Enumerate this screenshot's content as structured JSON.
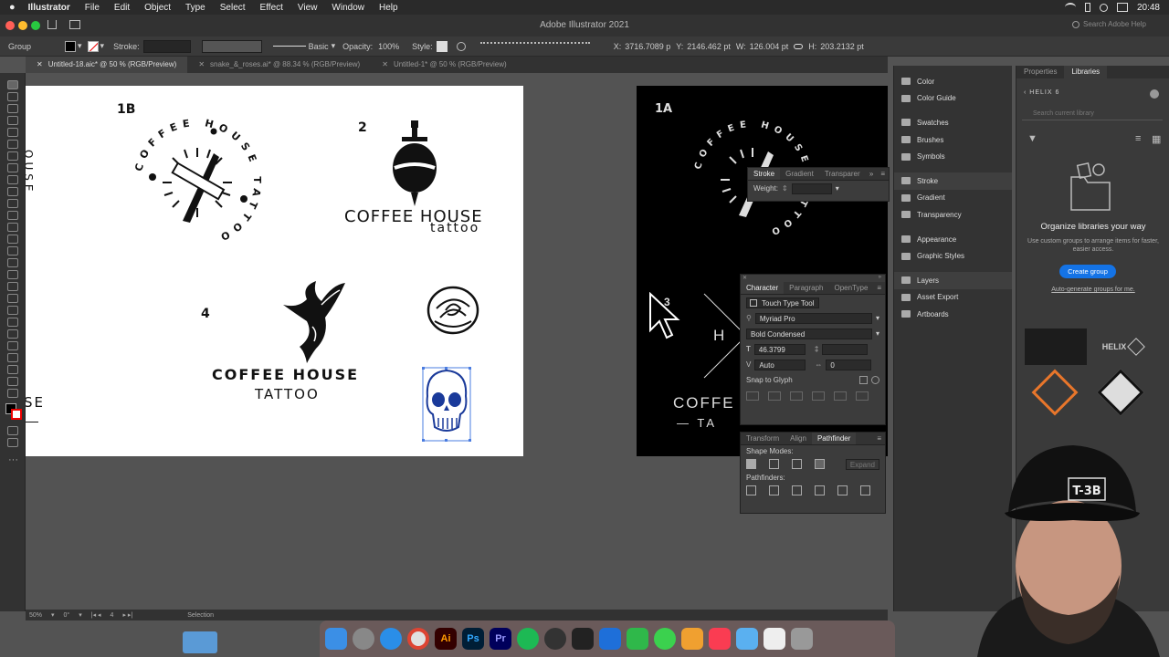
{
  "menubar": {
    "app_name": "Illustrator",
    "items": [
      "File",
      "Edit",
      "Object",
      "Type",
      "Select",
      "Effect",
      "View",
      "Window",
      "Help"
    ],
    "clock": "20:48"
  },
  "window": {
    "title": "Adobe Illustrator 2021",
    "search_placeholder": "Search Adobe Help"
  },
  "controlbar": {
    "selection_type": "Group",
    "stroke_label": "Stroke:",
    "brush_label": "Basic",
    "opacity_label": "Opacity:",
    "opacity_value": "100%",
    "style_label": "Style:",
    "x_label": "X:",
    "x_value": "3716.7089 p",
    "y_label": "Y:",
    "y_value": "2146.462 pt",
    "w_label": "W:",
    "w_value": "126.004 pt",
    "h_label": "H:",
    "h_value": "203.2132 pt"
  },
  "tabs": [
    {
      "label": "Untitled-18.aic* @ 50 % (RGB/Preview)"
    },
    {
      "label": "snake_&_roses.ai* @ 88.34 % (RGB/Preview)"
    },
    {
      "label": "Untitled-1* @ 50 % (RGB/Preview)"
    }
  ],
  "artboard_left": {
    "label_1b": "1B",
    "ring_text_1b": "COFFEE HOUSE TATTOO",
    "label_2": "2",
    "logo2_line1": "COFFEE HOUSE",
    "logo2_line2": "tattoo",
    "label_4": "4",
    "logo4_line1": "COFFEE HOUSE",
    "logo4_line2": "TATTOO",
    "partial_left_top": "OUSE",
    "partial_left_bottom": "SE"
  },
  "artboard_right": {
    "label_1a": "1A",
    "ring_text_1a": "COFFEE HOUSE TATTOO",
    "partial_3": "3",
    "partial_h": "H",
    "partial_coffee": "COFFE",
    "partial_ta": "— TA"
  },
  "stroke_panel": {
    "tabs": [
      "Stroke",
      "Gradient",
      "Transparer"
    ],
    "weight_label": "Weight:"
  },
  "character_panel": {
    "tabs": [
      "Character",
      "Paragraph",
      "OpenType"
    ],
    "touch_type": "Touch Type Tool",
    "font_family": "Myriad Pro",
    "font_style": "Bold Condensed",
    "font_size": "46.3799",
    "leading": "Auto",
    "tracking": "0",
    "snap_label": "Snap to Glyph"
  },
  "pathfinder_panel": {
    "tabs": [
      "Transform",
      "Align",
      "Pathfinder"
    ],
    "shape_modes": "Shape Modes:",
    "expand": "Expand",
    "pathfinders": "Pathfinders:"
  },
  "dock_panels": {
    "group1": [
      "Color",
      "Color Guide"
    ],
    "group2": [
      "Swatches",
      "Brushes",
      "Symbols"
    ],
    "group3": [
      "Stroke",
      "Gradient",
      "Transparency"
    ],
    "group4": [
      "Appearance",
      "Graphic Styles"
    ],
    "group5": [
      "Layers",
      "Asset Export",
      "Artboards"
    ]
  },
  "libraries": {
    "tabs": [
      "Properties",
      "Libraries"
    ],
    "library_name": "HELIX 6",
    "search_placeholder": "Search current library",
    "heading": "Organize libraries your way",
    "description": "Use custom groups to arrange items for faster, easier access.",
    "create_button": "Create group",
    "auto_link": "Auto-generate groups for me.",
    "thumb_text": "HELIX"
  },
  "statusbar": {
    "zoom": "50%",
    "rotation": "0°",
    "artboard_num": "4",
    "tool": "Selection"
  },
  "webcam": {
    "cap_text": "T-3B"
  },
  "colors": {
    "accent": "#1473e6",
    "panel_bg": "#3c3c3c",
    "canvas_bg": "#535353",
    "orange": "#e8762b"
  }
}
